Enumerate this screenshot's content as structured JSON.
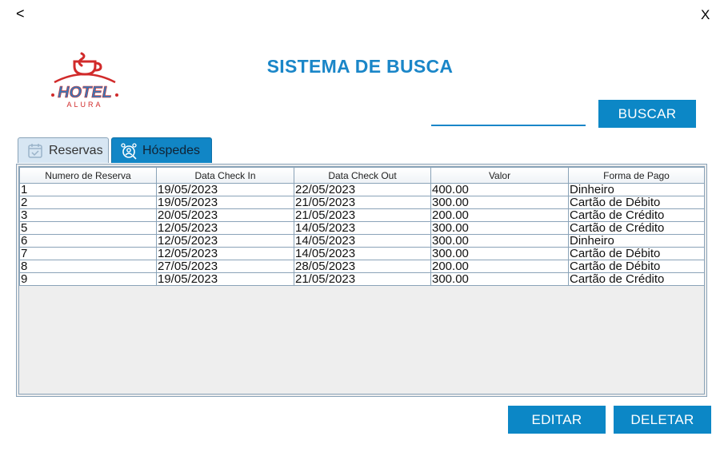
{
  "nav": {
    "back_label": "<",
    "close_label": "X"
  },
  "logo": {
    "brand": "HOTEL",
    "sub": "ALURA",
    "colors": {
      "red": "#d12a2a",
      "blue": "#3a77b5"
    }
  },
  "title": "SISTEMA DE BUSCA",
  "search": {
    "value": "",
    "placeholder": ""
  },
  "buttons": {
    "search": "BUSCAR",
    "edit": "EDITAR",
    "delete": "DELETAR"
  },
  "tabs": [
    {
      "label": "Reservas",
      "icon": "calendar-check-icon",
      "selected": true
    },
    {
      "label": "Hóspedes",
      "icon": "guests-search-icon",
      "selected": false
    }
  ],
  "table": {
    "headers": [
      "Numero de Reserva",
      "Data Check In",
      "Data Check Out",
      "Valor",
      "Forma de Pago"
    ],
    "rows": [
      [
        "1",
        "19/05/2023",
        "22/05/2023",
        "400.00",
        "Dinheiro"
      ],
      [
        "2",
        "19/05/2023",
        "21/05/2023",
        "300.00",
        "Cartão de Débito"
      ],
      [
        "3",
        "20/05/2023",
        "21/05/2023",
        "200.00",
        "Cartão de Crédito"
      ],
      [
        "5",
        "12/05/2023",
        "14/05/2023",
        "300.00",
        "Cartão de Crédito"
      ],
      [
        "6",
        "12/05/2023",
        "14/05/2023",
        "300.00",
        "Dinheiro"
      ],
      [
        "7",
        "12/05/2023",
        "14/05/2023",
        "300.00",
        "Cartão de Débito"
      ],
      [
        "8",
        "27/05/2023",
        "28/05/2023",
        "200.00",
        "Cartão de Débito"
      ],
      [
        "9",
        "19/05/2023",
        "21/05/2023",
        "300.00",
        "Cartão de Crédito"
      ]
    ]
  },
  "colors": {
    "accent": "#0c87c6",
    "title": "#1a86c8",
    "grid": "#8aa3b8"
  }
}
